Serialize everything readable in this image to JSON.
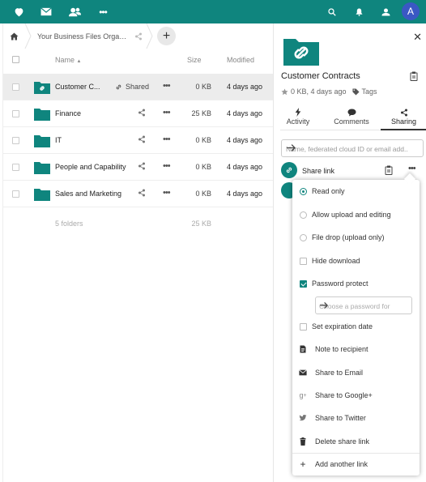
{
  "colors": {
    "brand": "#0f857e",
    "avatar": "#3a58c4"
  },
  "topbar": {
    "icons": [
      "heart-icon",
      "mail-icon",
      "contacts-icon",
      "more-icon",
      "search-icon",
      "notifications-icon",
      "contacts-menu-icon"
    ],
    "avatar_letter": "A"
  },
  "breadcrumb": {
    "current": "Your Business Files Organis..."
  },
  "table": {
    "headers": {
      "name": "Name",
      "size": "Size",
      "modified": "Modified"
    },
    "rows": [
      {
        "name": "Customer C...",
        "shared_label": "Shared",
        "size": "0 KB",
        "modified": "4 days ago"
      },
      {
        "name": "Finance",
        "size": "25 KB",
        "modified": "4 days ago"
      },
      {
        "name": "IT",
        "size": "0 KB",
        "modified": "4 days ago"
      },
      {
        "name": "People and Capability",
        "size": "0 KB",
        "modified": "4 days ago"
      },
      {
        "name": "Sales and Marketing",
        "size": "0 KB",
        "modified": "4 days ago"
      }
    ],
    "summary": {
      "count": "5 folders",
      "total": "25 KB"
    }
  },
  "sidebar": {
    "title": "Customer Contracts",
    "meta": "0 KB, 4 days ago",
    "tags_label": "Tags",
    "tabs": [
      {
        "label": "Activity"
      },
      {
        "label": "Comments"
      },
      {
        "label": "Sharing"
      }
    ],
    "share_input_placeholder": "Name, federated cloud ID or email add...",
    "share_link_label": "Share link"
  },
  "popover": {
    "items": [
      {
        "label": "Read only"
      },
      {
        "label": "Allow upload and editing"
      },
      {
        "label": "File drop (upload only)"
      },
      {
        "label": "Hide download"
      },
      {
        "label": "Password protect"
      },
      {
        "label": "Set expiration date"
      },
      {
        "label": "Note to recipient"
      },
      {
        "label": "Share to Email"
      },
      {
        "label": "Share to Google+"
      },
      {
        "label": "Share to Twitter"
      },
      {
        "label": "Delete share link"
      },
      {
        "label": "Add another link"
      }
    ],
    "password_placeholder": "Choose a password for"
  }
}
